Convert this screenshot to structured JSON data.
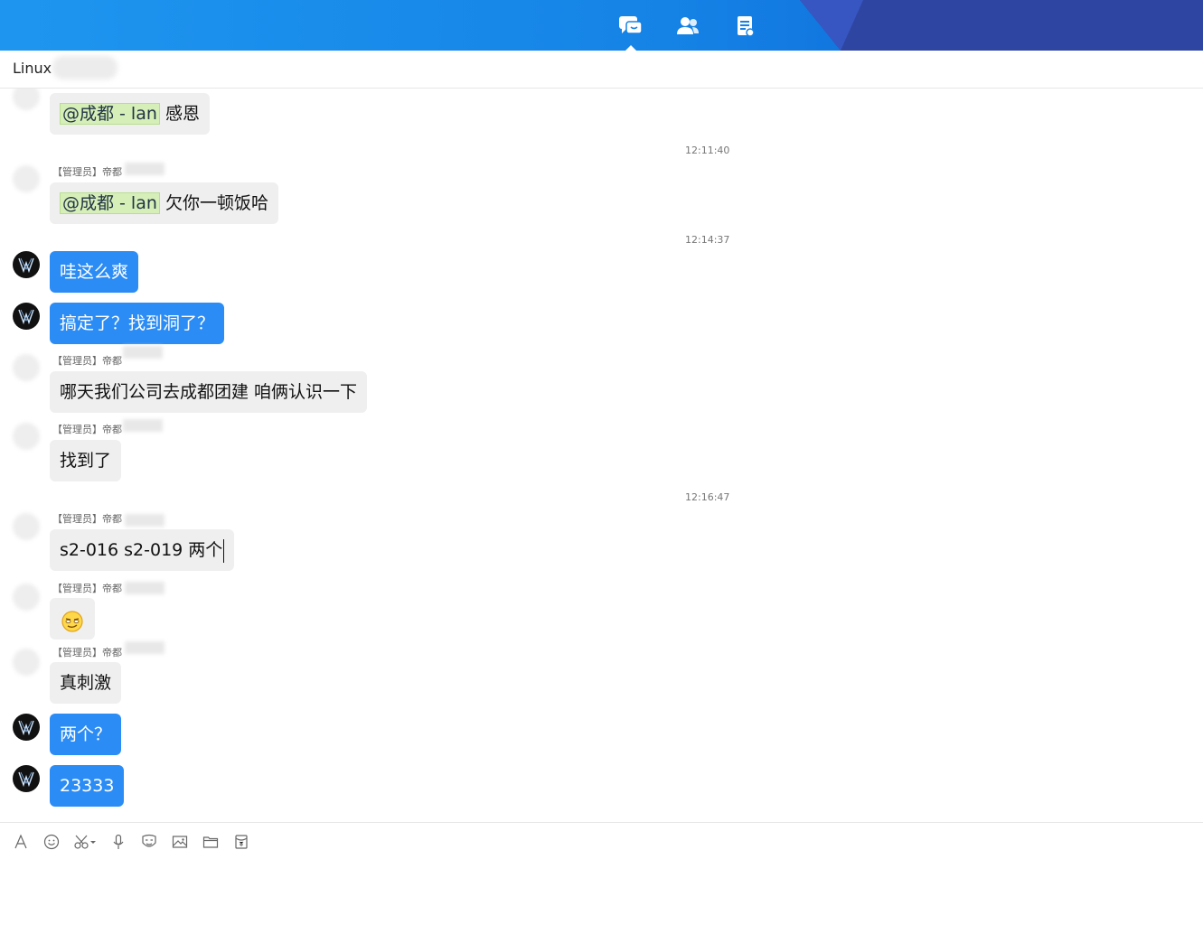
{
  "header": {
    "title": "Linux"
  },
  "top_tabs": [
    {
      "name": "messages",
      "icon": "chat-icon"
    },
    {
      "name": "contacts",
      "icon": "contacts-icon"
    },
    {
      "name": "notes",
      "icon": "notes-icon"
    }
  ],
  "messages": [
    {
      "kind": "in",
      "mention": "@成都 - lan",
      "text": "感恩"
    },
    {
      "kind": "time",
      "text": "12:11:40"
    },
    {
      "kind": "in",
      "sender": "【管理员】帝都",
      "mention": "@成都 - lan",
      "text": "欠你一顿饭哈"
    },
    {
      "kind": "time",
      "text": "12:14:37"
    },
    {
      "kind": "out",
      "text": "哇这么爽"
    },
    {
      "kind": "out",
      "text": "搞定了？找到洞了？"
    },
    {
      "kind": "in",
      "sender": "【管理员】帝都",
      "text": "哪天我们公司去成都团建  咱俩认识一下"
    },
    {
      "kind": "in",
      "sender": "【管理员】帝都",
      "text": "找到了"
    },
    {
      "kind": "time",
      "text": "12:16:47"
    },
    {
      "kind": "in",
      "sender": "【管理员】帝都",
      "text": "s2-016 s2-019  两个"
    },
    {
      "kind": "in",
      "sender": "【管理员】帝都",
      "emoji": "smirk-emoji"
    },
    {
      "kind": "in",
      "sender": "【管理员】帝都",
      "text": "真刺激"
    },
    {
      "kind": "out",
      "text": "两个？"
    },
    {
      "kind": "out",
      "text": "23333"
    }
  ],
  "toolbar": [
    {
      "name": "font-icon"
    },
    {
      "name": "emoji-icon"
    },
    {
      "name": "screenshot-icon"
    },
    {
      "name": "voice-icon"
    },
    {
      "name": "sticker-icon"
    },
    {
      "name": "image-icon"
    },
    {
      "name": "folder-icon"
    },
    {
      "name": "red-packet-icon"
    }
  ],
  "colors": {
    "topbar": "#1e96ef",
    "topbar_dark": "#2f45a2",
    "bubble_out": "#2b8cf5",
    "bubble_in": "#efefef",
    "mention_bg": "#d6efb9"
  }
}
